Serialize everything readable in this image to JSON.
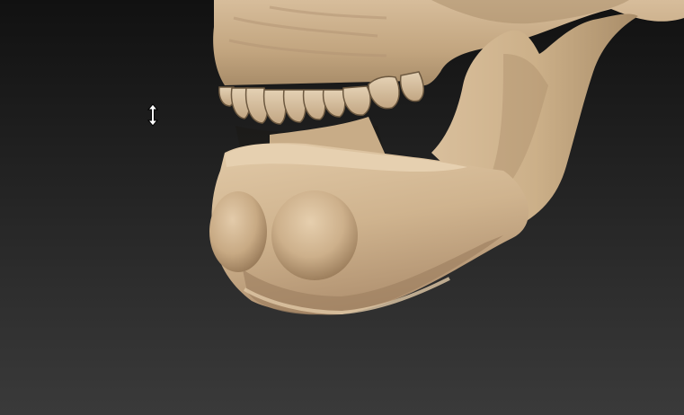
{
  "app": {
    "view": "3d-sculpt-viewport",
    "model": "skull-jaw-model",
    "cursor": "resize-vertical-icon"
  },
  "colors": {
    "bg_top": "#111111",
    "bg_bottom": "#3a3a3a",
    "bone_light": "#e0c7a5",
    "bone_mid": "#c9ad89",
    "bone_shadow": "#8e7454",
    "bone_deep": "#5e4a34",
    "teeth": "#d8c3a4",
    "teeth_line": "#6d5940"
  }
}
